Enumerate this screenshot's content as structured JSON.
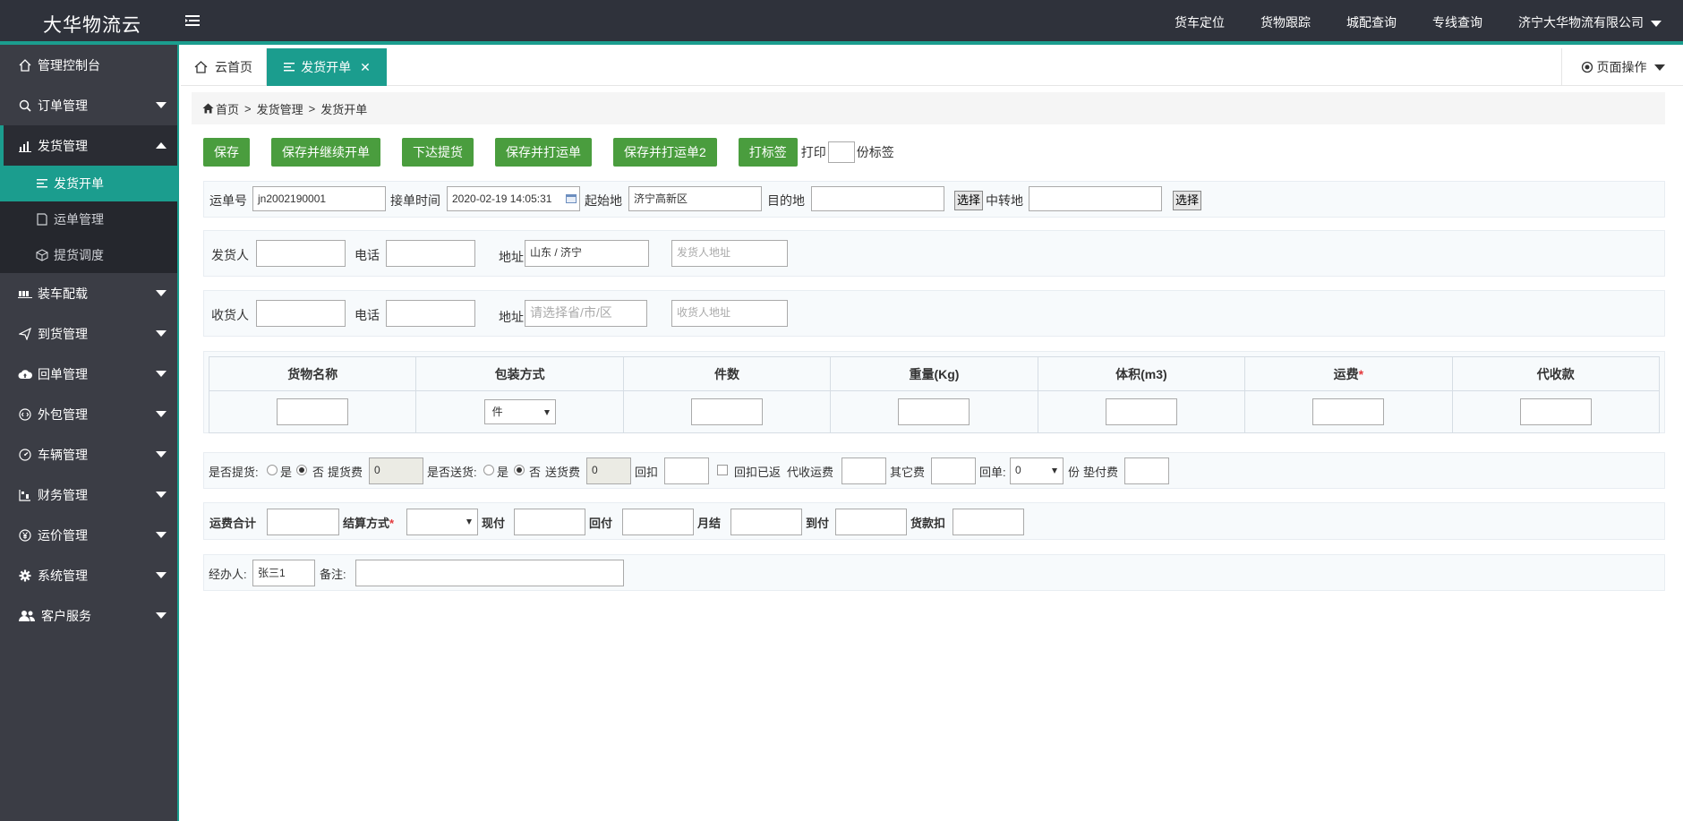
{
  "app": {
    "brand": "大华物流云",
    "top_links": [
      "货车定位",
      "货物跟踪",
      "城配查询",
      "专线查询"
    ],
    "company": "济宁大华物流有限公司"
  },
  "sidebar": {
    "items": [
      {
        "label": "管理控制台",
        "icon": "home-icon"
      },
      {
        "label": "订单管理",
        "icon": "search-icon"
      },
      {
        "label": "发货管理",
        "icon": "bar-chart-icon"
      },
      {
        "label": "装车配载",
        "icon": "truck-load-icon"
      },
      {
        "label": "到货管理",
        "icon": "send-icon"
      },
      {
        "label": "回单管理",
        "icon": "cloud-upload-icon"
      },
      {
        "label": "外包管理",
        "icon": "transfer-icon"
      },
      {
        "label": "车辆管理",
        "icon": "gauge-icon"
      },
      {
        "label": "财务管理",
        "icon": "finance-icon"
      },
      {
        "label": "运价管理",
        "icon": "yen-icon"
      },
      {
        "label": "系统管理",
        "icon": "gear-icon"
      },
      {
        "label": "客户服务",
        "icon": "users-icon"
      }
    ],
    "sub_items": [
      "发货开单",
      "运单管理",
      "提货调度"
    ]
  },
  "tabs": {
    "home": "云首页",
    "current": "发货开单",
    "page_ops": "页面操作"
  },
  "breadcrumb": {
    "home": "首页",
    "sep": ">",
    "section": "发货管理",
    "page": "发货开单"
  },
  "buttons": {
    "save": "保存",
    "save_continue": "保存并继续开单",
    "dispatch": "下达提货",
    "save_print": "保存并打运单",
    "save_print2": "保存并打运单2",
    "print_label": "打标签",
    "print_prefix": "打印",
    "print_suffix": "份标签"
  },
  "waybill": {
    "no_label": "运单号",
    "no_value": "jn2002190001",
    "time_label": "接单时间",
    "time_value": "2020-02-19 14:05:31",
    "origin_label": "起始地",
    "origin_value": "济宁高新区",
    "dest_label": "目的地",
    "select_btn": "选择",
    "transit_label": "中转地"
  },
  "shipper": {
    "name_label": "发货人",
    "phone_label": "电话",
    "addr_label": "地址",
    "addr_value": "山东 / 济宁",
    "addr_placeholder": "发货人地址"
  },
  "receiver": {
    "name_label": "收货人",
    "phone_label": "电话",
    "addr_label": "地址",
    "region_placeholder": "请选择省/市/区",
    "addr_placeholder": "收货人地址"
  },
  "goods": {
    "headers": [
      "货物名称",
      "包装方式",
      "件数",
      "重量(Kg)",
      "体积(m3)",
      "运费",
      "代收款"
    ],
    "required_mark": "*",
    "package_value": "件"
  },
  "delivery": {
    "pickup_label": "是否提货:",
    "yes": "是",
    "no": "否",
    "pickup_fee_label": "提货费",
    "pickup_fee_value": "0",
    "deliver_label": "是否送货:",
    "deliver_fee_label": "送货费",
    "deliver_fee_value": "0",
    "rebate_label": "回扣",
    "rebate_returned_label": "回扣已返",
    "cod_fee_label": "代收运费",
    "other_fee_label": "其它费",
    "receipt_label": "回单:",
    "receipt_value": "0",
    "copies_label": "份",
    "advance_fee_label": "垫付费"
  },
  "settlement": {
    "total_label": "运费合计",
    "method_label": "结算方式",
    "cash_label": "现付",
    "return_label": "回付",
    "monthly_label": "月结",
    "arrival_label": "到付",
    "deduct_label": "货款扣"
  },
  "handler": {
    "label": "经办人:",
    "value": "张三1",
    "note_label": "备注:"
  },
  "colors": {
    "topbar": "#2f323b",
    "sidebar": "#3b3d45",
    "accent": "#1b9d8e",
    "button_green": "#4a9d3e"
  }
}
